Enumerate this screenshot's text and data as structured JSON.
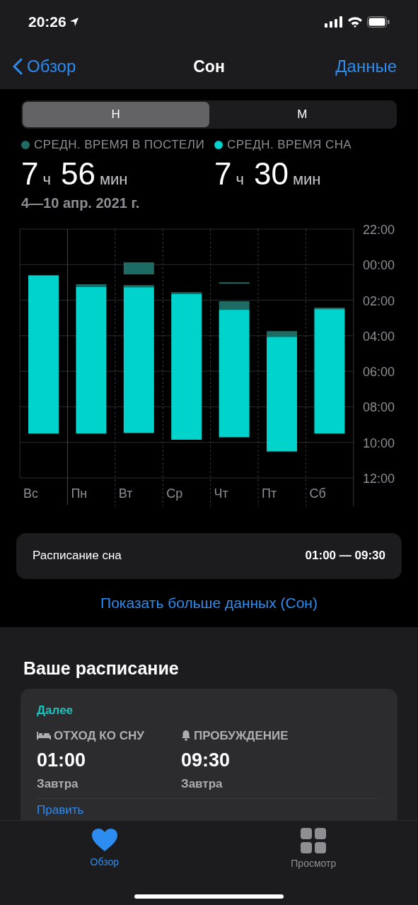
{
  "status_bar": {
    "time": "20:26"
  },
  "nav": {
    "back": "Обзор",
    "title": "Сон",
    "action": "Данные"
  },
  "segments": [
    {
      "label": "Н",
      "selected": true
    },
    {
      "label": "М",
      "selected": false
    }
  ],
  "stats": [
    {
      "label": "СРЕДН. ВРЕМЯ В ПОСТЕЛИ",
      "color": "#1e6b64",
      "hours": "7",
      "hours_unit": "ч",
      "minutes": "56",
      "minutes_unit": "мин"
    },
    {
      "label": "СРЕДН. ВРЕМЯ СНА",
      "color": "#00d3cc",
      "hours": "7",
      "hours_unit": "ч",
      "minutes": "30",
      "minutes_unit": "мин"
    }
  ],
  "date_range": "4—10 апр. 2021 г.",
  "sleep_chart": {
    "days": [
      "Вс",
      "Пн",
      "Вт",
      "Ср",
      "Чт",
      "Пт",
      "Сб"
    ],
    "time_labels": [
      "22:00",
      "00:00",
      "02:00",
      "04:00",
      "06:00",
      "08:00",
      "10:00",
      "12:00"
    ]
  },
  "schedule_row": {
    "label": "Расписание сна",
    "value": "01:00 — 09:30"
  },
  "more_link": "Показать больше данных (Сон)",
  "your_schedule": {
    "title": "Ваше расписание",
    "heading": "Далее",
    "items": [
      {
        "kind": "bed",
        "label": "ОТХОД КО СНУ",
        "time": "01:00",
        "day": "Завтра"
      },
      {
        "kind": "alarm",
        "label": "ПРОБУЖДЕНИЕ",
        "time": "09:30",
        "day": "Завтра"
      }
    ],
    "edit": "Править"
  },
  "tab_bar": [
    {
      "kind": "heart",
      "label": "Обзор",
      "selected": true
    },
    {
      "kind": "grid",
      "label": "Просмотр",
      "selected": false
    }
  ]
}
